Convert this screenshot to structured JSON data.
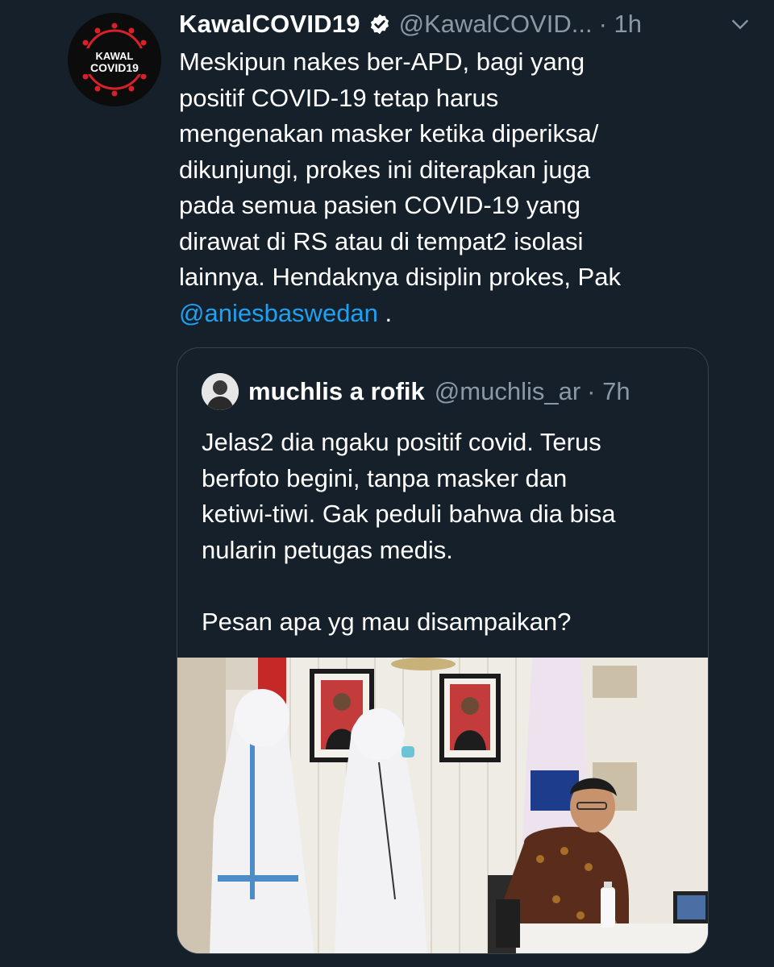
{
  "tweet": {
    "display_name": "KawalCOVID19",
    "handle": "@KawalCOVID...",
    "time": "· 1h",
    "text_before_mention": "Meskipun nakes ber-APD, bagi yang\npositif COVID-19 tetap harus\nmengenakan masker ketika diperiksa/\ndikunjungi, prokes ini diterapkan juga\npada semua pasien COVID-19 yang\ndirawat di RS atau di tempat2 isolasi\nlainnya. Hendaknya disiplin prokes, Pak\n",
    "mention": "@aniesbaswedan",
    "text_after_mention": " .",
    "avatar_logo_line1": "KAWAL",
    "avatar_logo_line2": "COVID19",
    "verified_icon": "verified-badge-icon",
    "menu_icon": "chevron-down-icon"
  },
  "quoted_tweet": {
    "display_name": "muchlis a rofik",
    "handle": "@muchlis_ar",
    "time": "· 7h",
    "text": "Jelas2 dia ngaku positif covid. Terus\nberfoto begini, tanpa masker dan\nketiwi-tiwi. Gak peduli bahwa dia bisa\nnularin petugas medis.\n\nPesan apa yg mau disampaikan?"
  },
  "colors": {
    "background": "#15202b",
    "text_primary": "#ffffff",
    "text_secondary": "#8b98a5",
    "link": "#1da1f2",
    "border": "#38444d",
    "logo_red": "#d8202a"
  }
}
